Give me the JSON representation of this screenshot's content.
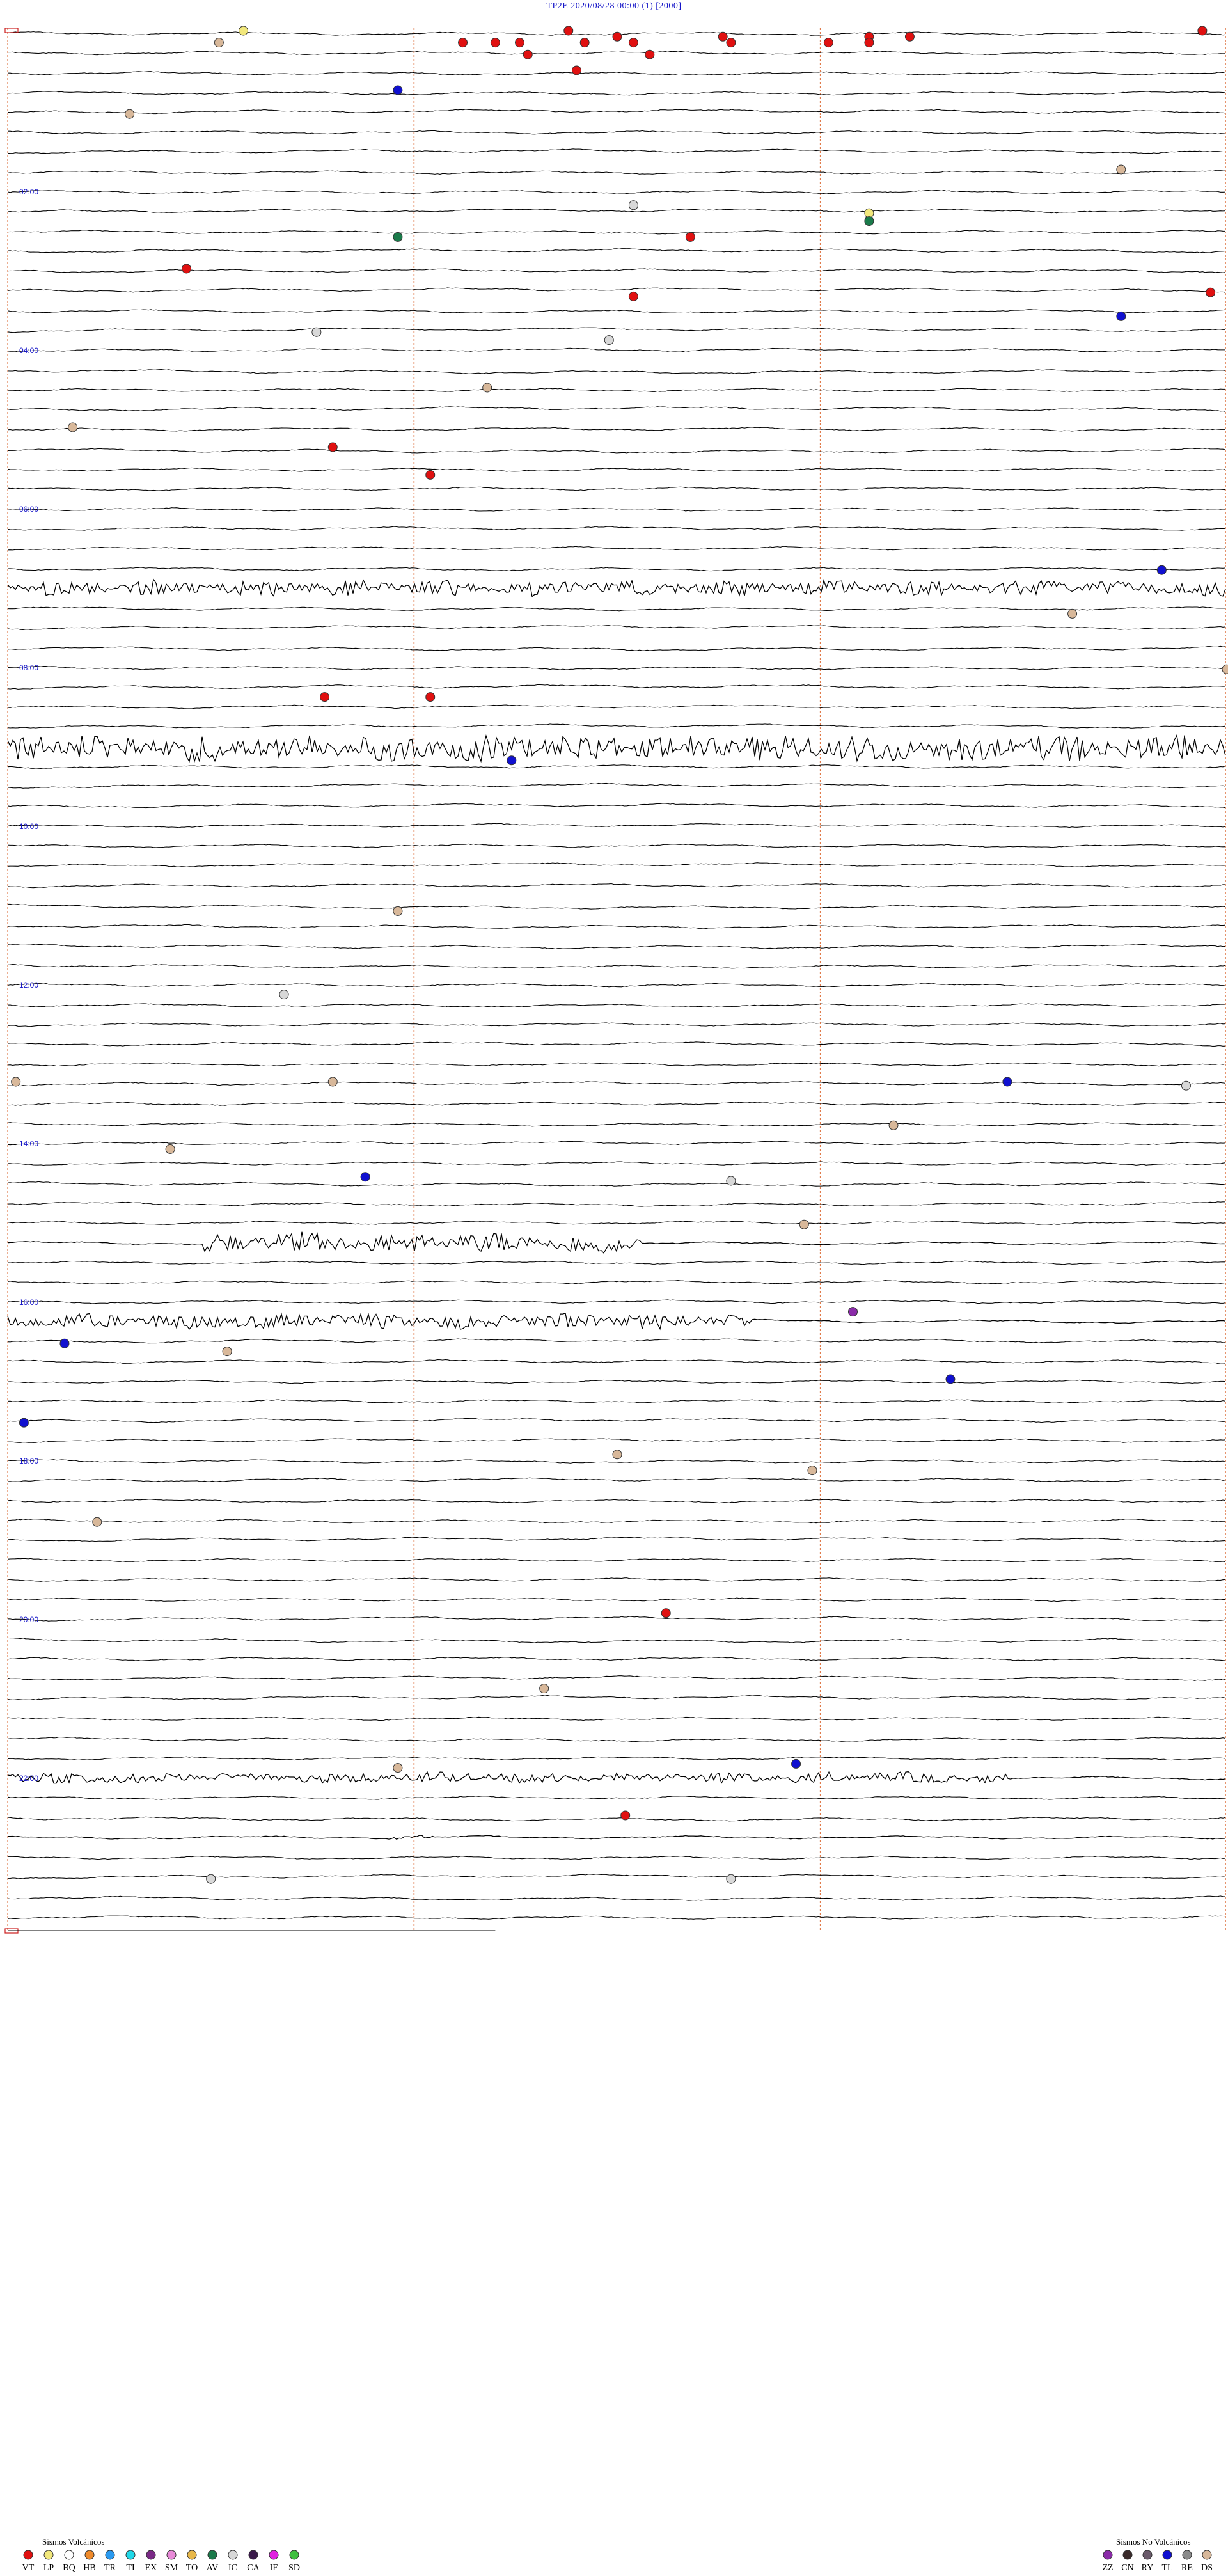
{
  "header": {
    "station": "TP2E",
    "datetime": "2020/08/28 00:00",
    "run": "(1)",
    "scale": "[2000]",
    "title": "TP2E     2020/08/28 00:00     (1)     [2000]"
  },
  "chart_data": {
    "type": "helicorder",
    "rows": 96,
    "minutes_per_row": 15,
    "minute_grid": [
      5,
      10,
      15
    ],
    "hour_labels": [
      "02:00",
      "04:00",
      "06:00",
      "08:00",
      "10:00",
      "12:00",
      "14:00",
      "16:00",
      "18:00",
      "20:00",
      "22:00"
    ],
    "hour_label_rows": [
      8,
      16,
      24,
      32,
      40,
      48,
      56,
      64,
      72,
      80,
      88
    ],
    "noise_bursts": [
      {
        "row": 28,
        "start": 0.0,
        "end": 1.0,
        "amp": 12
      },
      {
        "row": 36,
        "start": 0.0,
        "end": 1.0,
        "amp": 22
      },
      {
        "row": 61,
        "start": 0.16,
        "end": 0.52,
        "amp": 16
      },
      {
        "row": 65,
        "start": 0.0,
        "end": 0.61,
        "amp": 12
      },
      {
        "row": 88,
        "start": 0.0,
        "end": 0.82,
        "amp": 8
      },
      {
        "row": 91,
        "start": 0.31,
        "end": 0.35,
        "amp": 3
      }
    ],
    "events": [
      {
        "type": "LP",
        "row": 0.0,
        "minute": 2.9
      },
      {
        "type": "DS",
        "row": 0.6,
        "minute": 2.6
      },
      {
        "type": "VT",
        "row": 0.0,
        "minute": 6.9
      },
      {
        "type": "VT",
        "row": 0.6,
        "minute": 5.6
      },
      {
        "type": "VT",
        "row": 0.6,
        "minute": 6.0
      },
      {
        "type": "VT",
        "row": 0.6,
        "minute": 6.3
      },
      {
        "type": "VT",
        "row": 0.3,
        "minute": 7.5
      },
      {
        "type": "VT",
        "row": 0.6,
        "minute": 7.1
      },
      {
        "type": "VT",
        "row": 0.6,
        "minute": 7.7
      },
      {
        "type": "VT",
        "row": 1.2,
        "minute": 6.4
      },
      {
        "type": "VT",
        "row": 1.2,
        "minute": 7.9
      },
      {
        "type": "VT",
        "row": 2.0,
        "minute": 7.0
      },
      {
        "type": "VT",
        "row": 0.3,
        "minute": 8.8
      },
      {
        "type": "VT",
        "row": 0.6,
        "minute": 8.9
      },
      {
        "type": "VT",
        "row": 0.6,
        "minute": 10.1
      },
      {
        "type": "VT",
        "row": 0.3,
        "minute": 10.6
      },
      {
        "type": "VT",
        "row": 0.6,
        "minute": 10.6
      },
      {
        "type": "VT",
        "row": 0.3,
        "minute": 11.1
      },
      {
        "type": "VT",
        "row": 0.0,
        "minute": 14.7
      },
      {
        "type": "TL",
        "row": 3.0,
        "minute": 4.8
      },
      {
        "type": "DS",
        "row": 4.2,
        "minute": 1.5
      },
      {
        "type": "DS",
        "row": 7.0,
        "minute": 13.7
      },
      {
        "type": "IC",
        "row": 8.8,
        "minute": 7.7
      },
      {
        "type": "LP",
        "row": 9.2,
        "minute": 10.6
      },
      {
        "type": "AV",
        "row": 9.6,
        "minute": 10.6
      },
      {
        "type": "AV",
        "row": 10.4,
        "minute": 4.8
      },
      {
        "type": "VT",
        "row": 10.4,
        "minute": 8.4
      },
      {
        "type": "VT",
        "row": 12.0,
        "minute": 2.2
      },
      {
        "type": "VT",
        "row": 13.4,
        "minute": 7.7
      },
      {
        "type": "VT",
        "row": 13.2,
        "minute": 14.8
      },
      {
        "type": "TL",
        "row": 14.4,
        "minute": 13.7
      },
      {
        "type": "IC",
        "row": 15.2,
        "minute": 3.8
      },
      {
        "type": "IC",
        "row": 15.6,
        "minute": 7.4
      },
      {
        "type": "DS",
        "row": 18.0,
        "minute": 5.9
      },
      {
        "type": "DS",
        "row": 20.0,
        "minute": 0.8
      },
      {
        "type": "VT",
        "row": 21.0,
        "minute": 4.0
      },
      {
        "type": "VT",
        "row": 22.4,
        "minute": 5.2
      },
      {
        "type": "TL",
        "row": 27.2,
        "minute": 14.2
      },
      {
        "type": "DS",
        "row": 29.4,
        "minute": 13.1
      },
      {
        "type": "DS",
        "row": 32.2,
        "minute": 15.0
      },
      {
        "type": "VT",
        "row": 33.6,
        "minute": 3.9
      },
      {
        "type": "VT",
        "row": 33.6,
        "minute": 5.2
      },
      {
        "type": "TL",
        "row": 36.8,
        "minute": 6.2
      },
      {
        "type": "DS",
        "row": 44.4,
        "minute": 4.8
      },
      {
        "type": "IC",
        "row": 48.6,
        "minute": 3.4
      },
      {
        "type": "DS",
        "row": 53.0,
        "minute": 0.1
      },
      {
        "type": "DS",
        "row": 53.0,
        "minute": 4.0
      },
      {
        "type": "TL",
        "row": 53.0,
        "minute": 12.3
      },
      {
        "type": "IC",
        "row": 53.2,
        "minute": 14.5
      },
      {
        "type": "DS",
        "row": 55.2,
        "minute": 10.9
      },
      {
        "type": "DS",
        "row": 56.4,
        "minute": 2.0
      },
      {
        "type": "TL",
        "row": 57.8,
        "minute": 4.4
      },
      {
        "type": "IC",
        "row": 58.0,
        "minute": 8.9
      },
      {
        "type": "DS",
        "row": 60.2,
        "minute": 9.8
      },
      {
        "type": "ZZ",
        "row": 64.6,
        "minute": 10.4
      },
      {
        "type": "TL",
        "row": 66.2,
        "minute": 0.7
      },
      {
        "type": "DS",
        "row": 66.6,
        "minute": 2.7
      },
      {
        "type": "TL",
        "row": 68.0,
        "minute": 11.6
      },
      {
        "type": "TL",
        "row": 70.2,
        "minute": 0.2
      },
      {
        "type": "DS",
        "row": 71.8,
        "minute": 7.5
      },
      {
        "type": "DS",
        "row": 72.6,
        "minute": 9.9
      },
      {
        "type": "DS",
        "row": 75.2,
        "minute": 1.1
      },
      {
        "type": "VT",
        "row": 79.8,
        "minute": 8.1
      },
      {
        "type": "DS",
        "row": 83.6,
        "minute": 6.6
      },
      {
        "type": "TL",
        "row": 87.4,
        "minute": 9.7
      },
      {
        "type": "DS",
        "row": 87.6,
        "minute": 4.8
      },
      {
        "type": "VT",
        "row": 90.0,
        "minute": 7.6
      },
      {
        "type": "IC",
        "row": 93.2,
        "minute": 2.5
      },
      {
        "type": "IC",
        "row": 93.2,
        "minute": 8.9
      }
    ]
  },
  "legend": {
    "volcanic": {
      "title": "Sismos Volcánicos",
      "items": [
        {
          "code": "VT",
          "color": "#e01010"
        },
        {
          "code": "LP",
          "color": "#f2e87c"
        },
        {
          "code": "BQ",
          "color": "#ffffff"
        },
        {
          "code": "HB",
          "color": "#f08a2a"
        },
        {
          "code": "TR",
          "color": "#2a9af0"
        },
        {
          "code": "TI",
          "color": "#20d8e8"
        },
        {
          "code": "EX",
          "color": "#7a2a86"
        },
        {
          "code": "SM",
          "color": "#e88ad8"
        },
        {
          "code": "TO",
          "color": "#e8b84a"
        },
        {
          "code": "AV",
          "color": "#1a7a4a"
        },
        {
          "code": "IC",
          "color": "#d8d8d8"
        },
        {
          "code": "CA",
          "color": "#3a1a4a"
        },
        {
          "code": "IF",
          "color": "#e020e0"
        },
        {
          "code": "SD",
          "color": "#40c040"
        }
      ]
    },
    "non_volcanic": {
      "title": "Sismos No Volcánicos",
      "items": [
        {
          "code": "ZZ",
          "color": "#8a2aa8"
        },
        {
          "code": "CN",
          "color": "#3a2a2a"
        },
        {
          "code": "RY",
          "color": "#6a5a6a"
        },
        {
          "code": "TL",
          "color": "#1010d0"
        },
        {
          "code": "RE",
          "color": "#8a8a8a"
        },
        {
          "code": "DS",
          "color": "#d8b89a"
        }
      ]
    }
  },
  "colors": {
    "trace": "#000000",
    "minute_grid": "#e07a4a",
    "hour_label": "#1515c8",
    "title": "#1515c8",
    "event_outline": "#333333",
    "row_marker": "#cc2020"
  }
}
